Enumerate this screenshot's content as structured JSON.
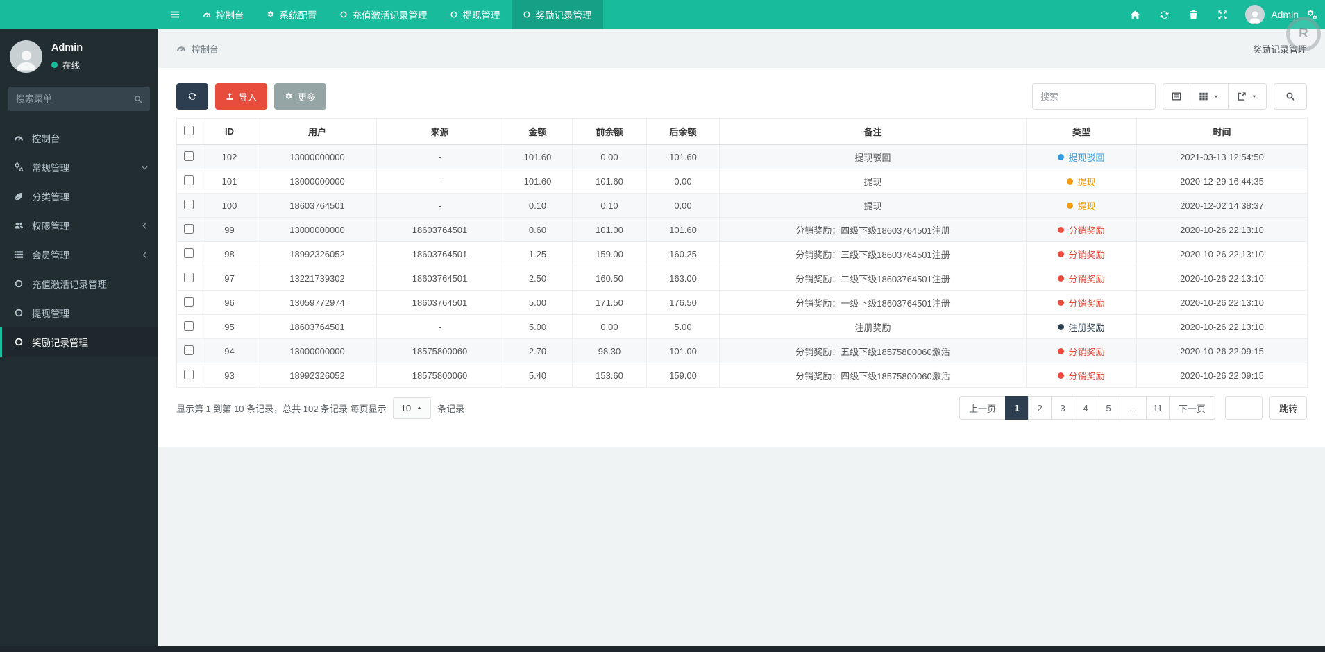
{
  "colors": {
    "teal": "#18BC9C",
    "navy": "#2C3E50",
    "red": "#E74C3C",
    "gray": "#95A5A6",
    "blue": "#3498DB",
    "orange": "#F39C12"
  },
  "navbar": {
    "tabs": [
      {
        "name": "console",
        "label": "控制台",
        "icon": "dashboard",
        "active": false
      },
      {
        "name": "system-config",
        "label": "系统配置",
        "icon": "gear",
        "active": false
      },
      {
        "name": "recharge-activation-log",
        "label": "充值激活记录管理",
        "icon": "circle",
        "active": false
      },
      {
        "name": "withdraw",
        "label": "提现管理",
        "icon": "circle",
        "active": false
      },
      {
        "name": "reward-log",
        "label": "奖励记录管理",
        "icon": "circle",
        "active": true
      }
    ],
    "right_icons": [
      {
        "name": "home"
      },
      {
        "name": "refresh"
      },
      {
        "name": "trash"
      },
      {
        "name": "expand"
      }
    ],
    "user": {
      "name": "Admin"
    }
  },
  "watermark": "R",
  "sidebar": {
    "user": {
      "name": "Admin",
      "status": "在线"
    },
    "search_placeholder": "搜索菜单",
    "items": [
      {
        "name": "console",
        "label": "控制台",
        "icon": "dashboard"
      },
      {
        "name": "general",
        "label": "常规管理",
        "icon": "cogs",
        "chevron": "down"
      },
      {
        "name": "category",
        "label": "分类管理",
        "icon": "leaf"
      },
      {
        "name": "auth",
        "label": "权限管理",
        "icon": "users",
        "chevron": "left"
      },
      {
        "name": "member",
        "label": "会员管理",
        "icon": "list",
        "chevron": "left"
      },
      {
        "name": "recharge-activation-log",
        "label": "充值激活记录管理",
        "icon": "circle"
      },
      {
        "name": "withdraw",
        "label": "提现管理",
        "icon": "circle"
      },
      {
        "name": "reward-log",
        "label": "奖励记录管理",
        "icon": "circle",
        "active": true
      }
    ]
  },
  "breadcrumb": {
    "label": "控制台"
  },
  "page_title": "奖励记录管理",
  "toolbar": {
    "import_label": "导入",
    "more_label": "更多",
    "search_placeholder": "搜索"
  },
  "table": {
    "columns": [
      {
        "key": "id",
        "label": "ID"
      },
      {
        "key": "user",
        "label": "用户"
      },
      {
        "key": "source",
        "label": "来源"
      },
      {
        "key": "amount",
        "label": "金额"
      },
      {
        "key": "before",
        "label": "前余额"
      },
      {
        "key": "after",
        "label": "后余额"
      },
      {
        "key": "memo",
        "label": "备注"
      },
      {
        "key": "type",
        "label": "类型"
      },
      {
        "key": "time",
        "label": "时间"
      }
    ],
    "rows": [
      {
        "id": "102",
        "user": "13000000000",
        "source": "-",
        "amount": "101.60",
        "before": "0.00",
        "after": "101.60",
        "memo": "提现驳回",
        "type": {
          "label": "提现驳回",
          "color": "#3498DB"
        },
        "time": "2021-03-13 12:54:50",
        "striped": true
      },
      {
        "id": "101",
        "user": "13000000000",
        "source": "-",
        "amount": "101.60",
        "before": "101.60",
        "after": "0.00",
        "memo": "提现",
        "type": {
          "label": "提现",
          "color": "#F39C12"
        },
        "time": "2020-12-29 16:44:35",
        "striped": false
      },
      {
        "id": "100",
        "user": "18603764501",
        "source": "-",
        "amount": "0.10",
        "before": "0.10",
        "after": "0.00",
        "memo": "提现",
        "type": {
          "label": "提现",
          "color": "#F39C12"
        },
        "time": "2020-12-02 14:38:37",
        "striped": true
      },
      {
        "id": "99",
        "user": "13000000000",
        "source": "18603764501",
        "amount": "0.60",
        "before": "101.00",
        "after": "101.60",
        "memo": "分销奖励：四级下级18603764501注册",
        "type": {
          "label": "分销奖励",
          "color": "#E74C3C"
        },
        "time": "2020-10-26 22:13:10",
        "striped": true
      },
      {
        "id": "98",
        "user": "18992326052",
        "source": "18603764501",
        "amount": "1.25",
        "before": "159.00",
        "after": "160.25",
        "memo": "分销奖励：三级下级18603764501注册",
        "type": {
          "label": "分销奖励",
          "color": "#E74C3C"
        },
        "time": "2020-10-26 22:13:10",
        "striped": false
      },
      {
        "id": "97",
        "user": "13221739302",
        "source": "18603764501",
        "amount": "2.50",
        "before": "160.50",
        "after": "163.00",
        "memo": "分销奖励：二级下级18603764501注册",
        "type": {
          "label": "分销奖励",
          "color": "#E74C3C"
        },
        "time": "2020-10-26 22:13:10",
        "striped": false
      },
      {
        "id": "96",
        "user": "13059772974",
        "source": "18603764501",
        "amount": "5.00",
        "before": "171.50",
        "after": "176.50",
        "memo": "分销奖励：一级下级18603764501注册",
        "type": {
          "label": "分销奖励",
          "color": "#E74C3C"
        },
        "time": "2020-10-26 22:13:10",
        "striped": false
      },
      {
        "id": "95",
        "user": "18603764501",
        "source": "-",
        "amount": "5.00",
        "before": "0.00",
        "after": "5.00",
        "memo": "注册奖励",
        "type": {
          "label": "注册奖励",
          "color": "#2C3E50"
        },
        "time": "2020-10-26 22:13:10",
        "striped": false
      },
      {
        "id": "94",
        "user": "13000000000",
        "source": "18575800060",
        "amount": "2.70",
        "before": "98.30",
        "after": "101.00",
        "memo": "分销奖励：五级下级18575800060激活",
        "type": {
          "label": "分销奖励",
          "color": "#E74C3C"
        },
        "time": "2020-10-26 22:09:15",
        "striped": true
      },
      {
        "id": "93",
        "user": "18992326052",
        "source": "18575800060",
        "amount": "5.40",
        "before": "153.60",
        "after": "159.00",
        "memo": "分销奖励：四级下级18575800060激活",
        "type": {
          "label": "分销奖励",
          "color": "#E74C3C"
        },
        "time": "2020-10-26 22:09:15",
        "striped": false
      }
    ]
  },
  "footer": {
    "info_prefix": "显示第 1 到第 10 条记录，总共 102 条记录 每页显示",
    "page_size": "10",
    "info_suffix": "条记录",
    "pages": [
      "上一页",
      "1",
      "2",
      "3",
      "4",
      "5",
      "...",
      "11",
      "下一页"
    ],
    "active_page": "1",
    "jump_label": "跳转"
  }
}
